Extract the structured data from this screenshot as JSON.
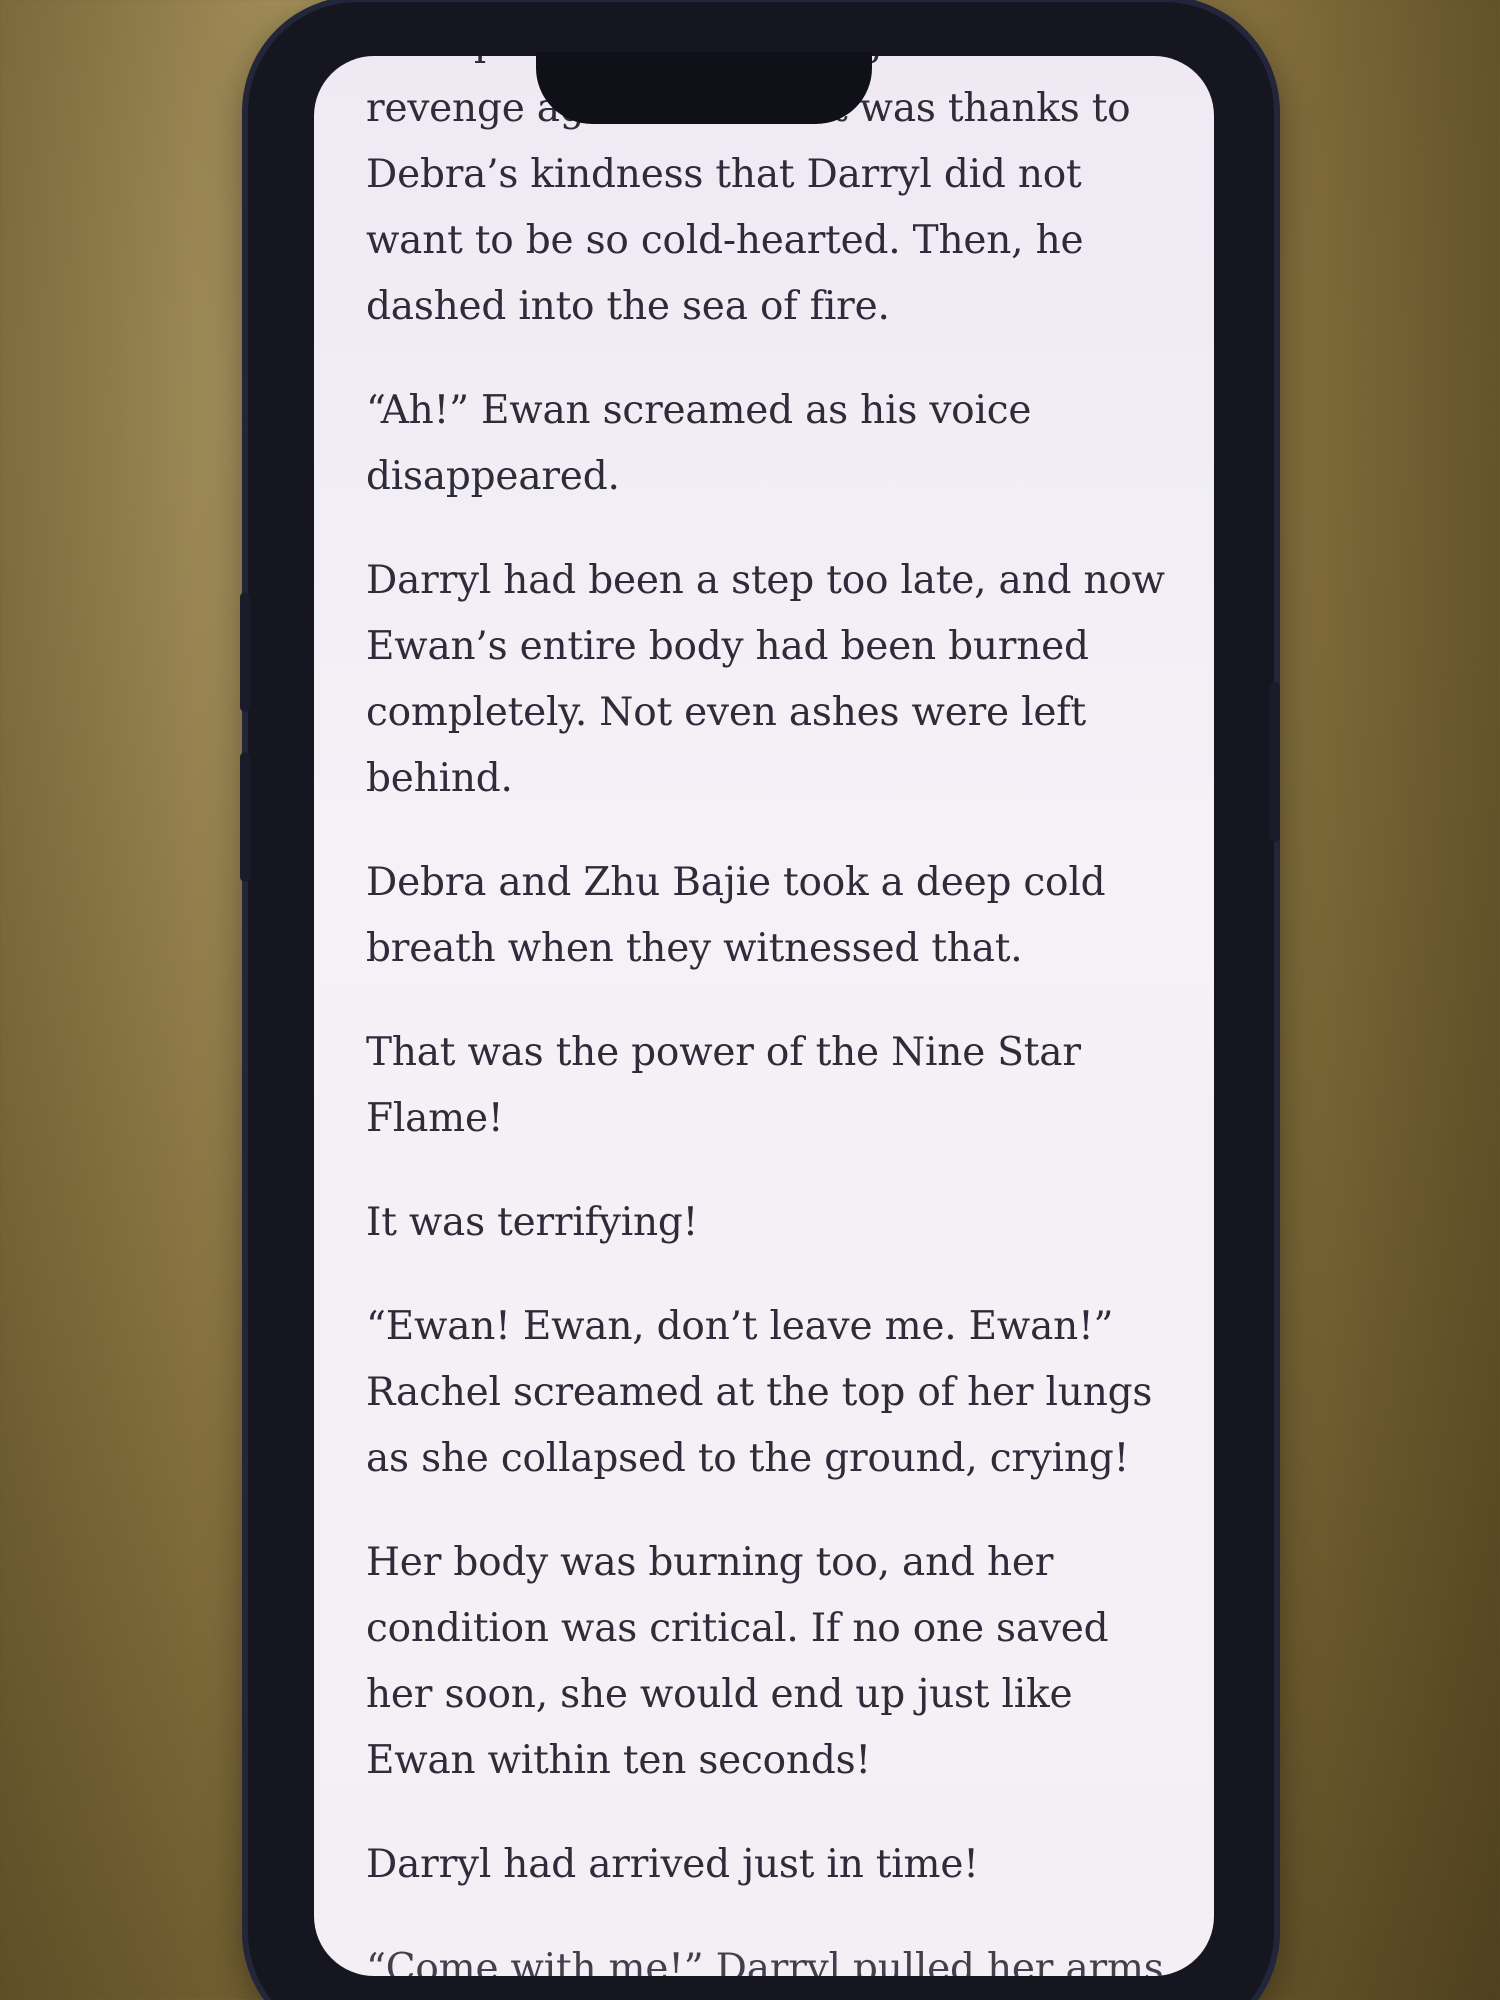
{
  "reader": {
    "paragraphs": [
      "triumph that it never sought out revenge against them. It was thanks to Debra’s kindness that Darryl did not want to be so cold-hearted. Then, he dashed into the sea of fire.",
      "“Ah!” Ewan screamed as his voice disappeared.",
      "Darryl had been a step too late, and now Ewan’s entire body had been burned completely. Not even ashes were left behind.",
      "Debra and Zhu Bajie took a deep cold breath when they witnessed that.",
      "That was the power of the Nine Star Flame!",
      "It was terrifying!",
      "“Ewan! Ewan, don’t leave me. Ewan!” Rachel screamed at the top of her lungs as she collapsed to the ground, crying!",
      "Her body was burning too, and her condition was critical. If no one saved her soon, she would end up just like Ewan within ten seconds!",
      "Darryl had arrived just in time!",
      "“Come with me!” Darryl pulled her arms"
    ]
  },
  "colors": {
    "screen_background": "#f3eff5",
    "text": "#2e2c3a",
    "phone_frame": "#15161f"
  }
}
